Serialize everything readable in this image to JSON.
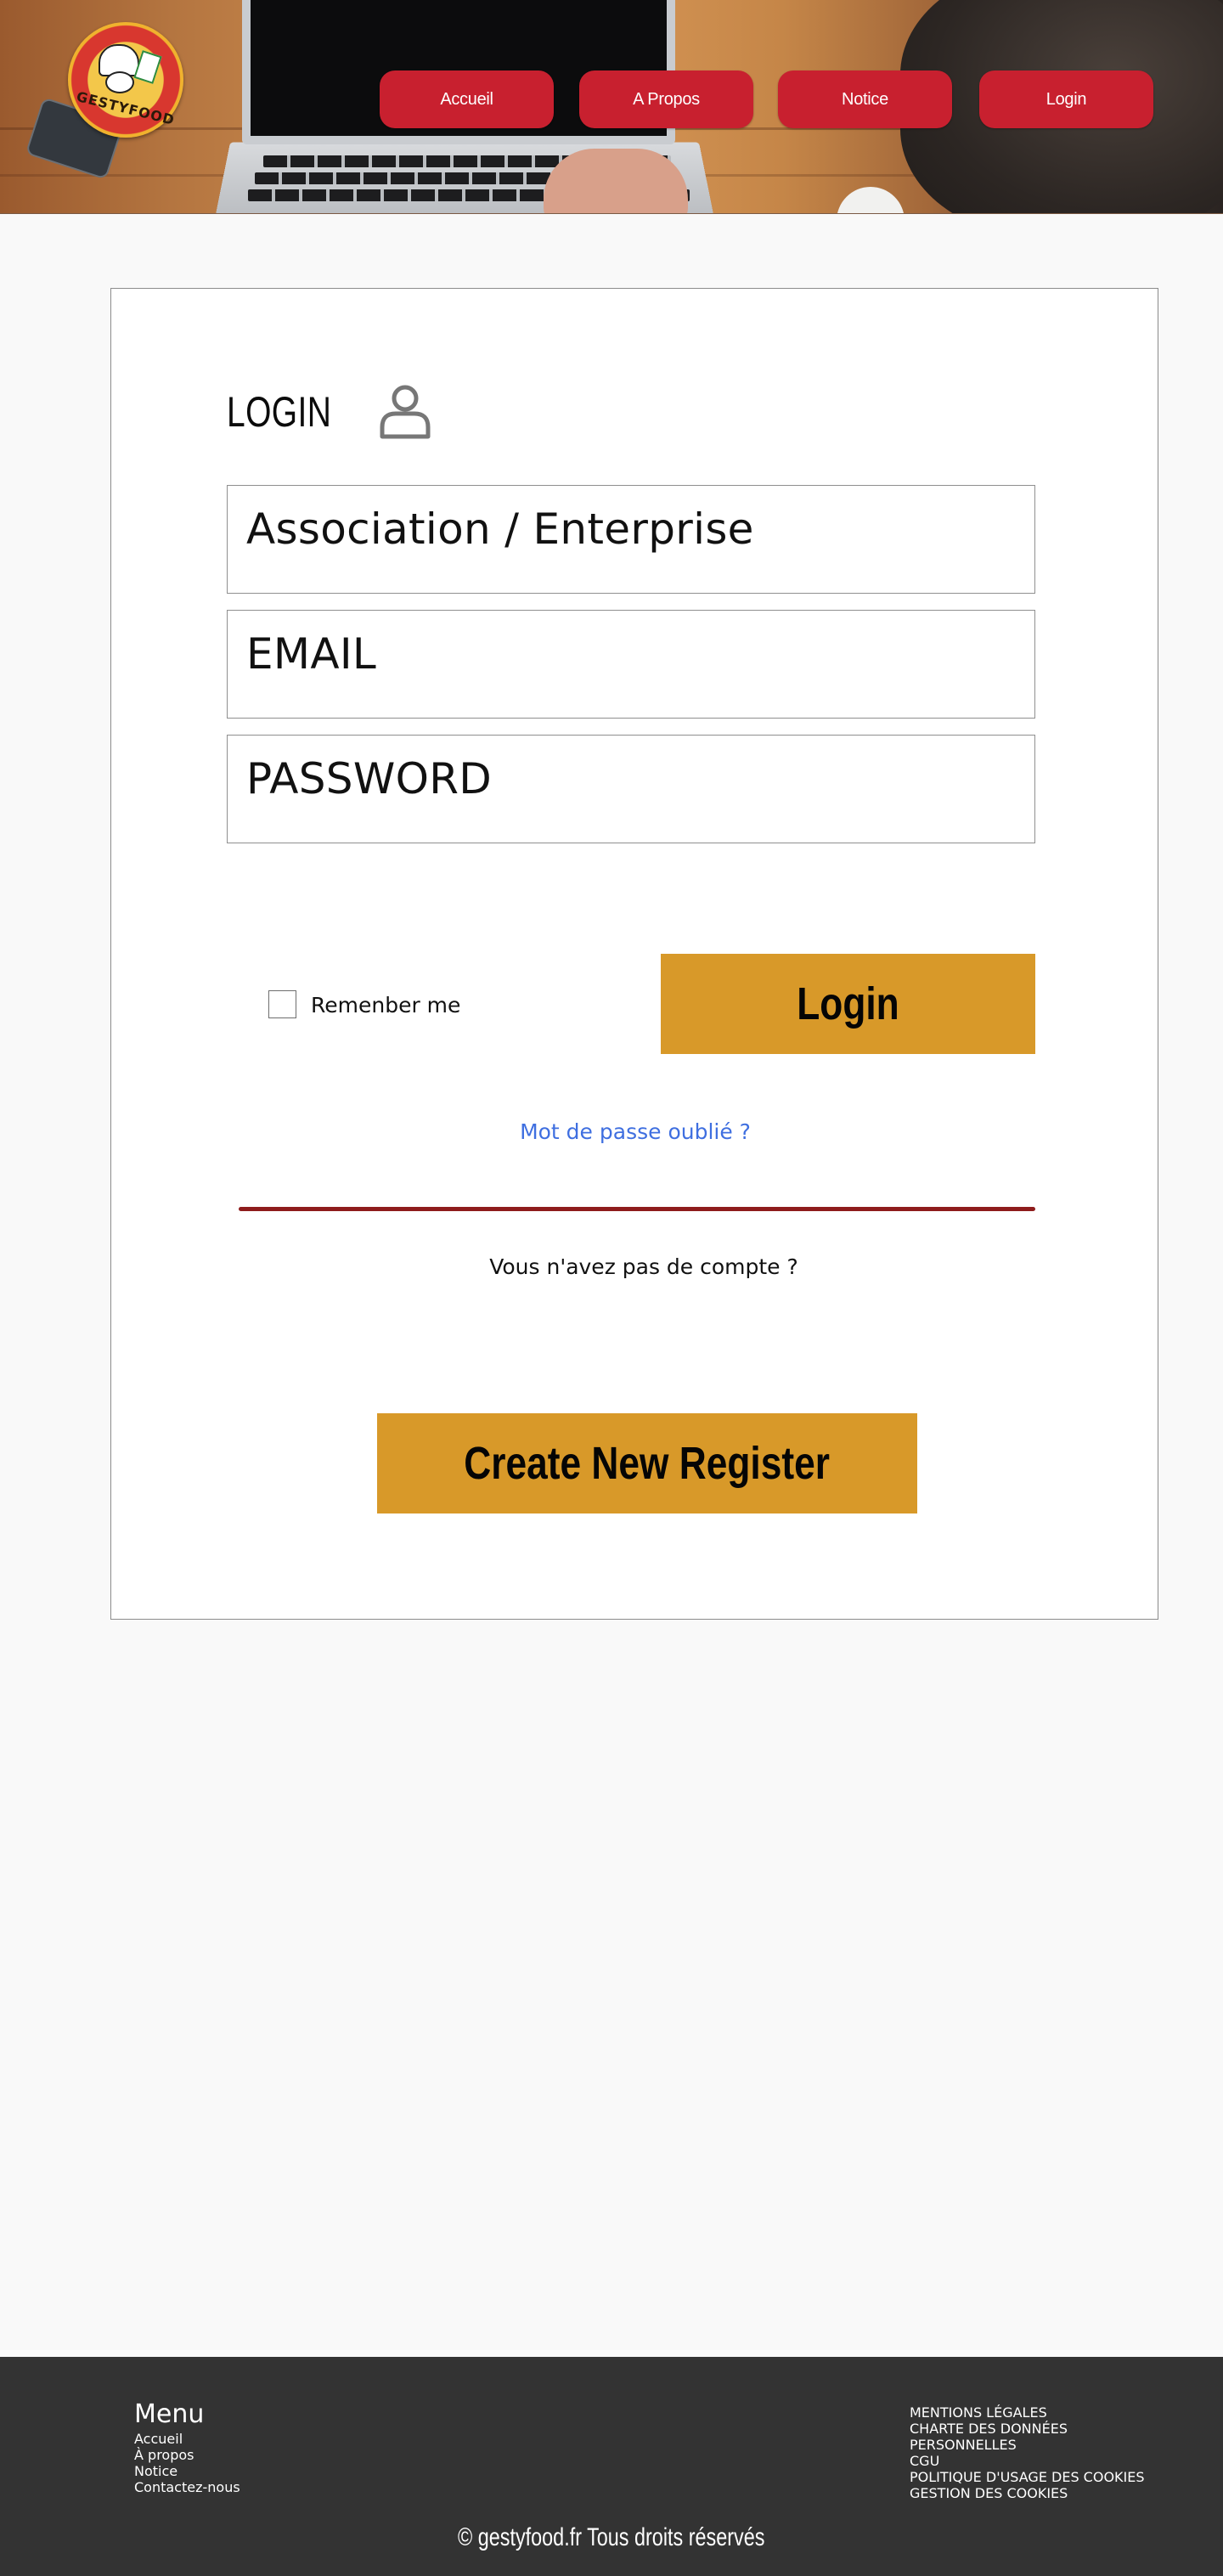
{
  "header": {
    "logo_text": "GESTYFOOD",
    "nav": [
      {
        "label": "Accueil"
      },
      {
        "label": "A Propos"
      },
      {
        "label": "Notice"
      },
      {
        "label": "Login"
      }
    ]
  },
  "login": {
    "title": "LOGIN",
    "fields": {
      "association_placeholder": "Association / Enterprise",
      "email_placeholder": "EMAIL",
      "password_placeholder": "PASSWORD"
    },
    "remember_label": "Remenber me",
    "login_button": "Login",
    "forgot_link": "Mot de passe oublié ?",
    "no_account_text": "Vous n'avez pas de compte ?",
    "register_button": "Create New Register"
  },
  "footer": {
    "menu_title": "Menu",
    "menu_items": [
      "Accueil",
      "À propos",
      "Notice",
      "Contactez-nous"
    ],
    "legal_items": [
      "MENTIONS LÉGALES",
      "CHARTE DES DONNÉES",
      "PERSONNELLES",
      "CGU",
      "POLITIQUE D'USAGE DES COOKIES",
      "GESTION DES COOKIES"
    ],
    "copyright": "© gestyfood.fr  Tous droits réservés"
  },
  "colors": {
    "nav_red": "#c8202f",
    "button_gold": "#d89929",
    "link_blue": "#3f6fe0",
    "divider_red": "#8e1c1c",
    "footer_bg": "#333333"
  },
  "icons": {
    "user": "user-outline-icon",
    "checkbox": "checkbox-unchecked"
  }
}
